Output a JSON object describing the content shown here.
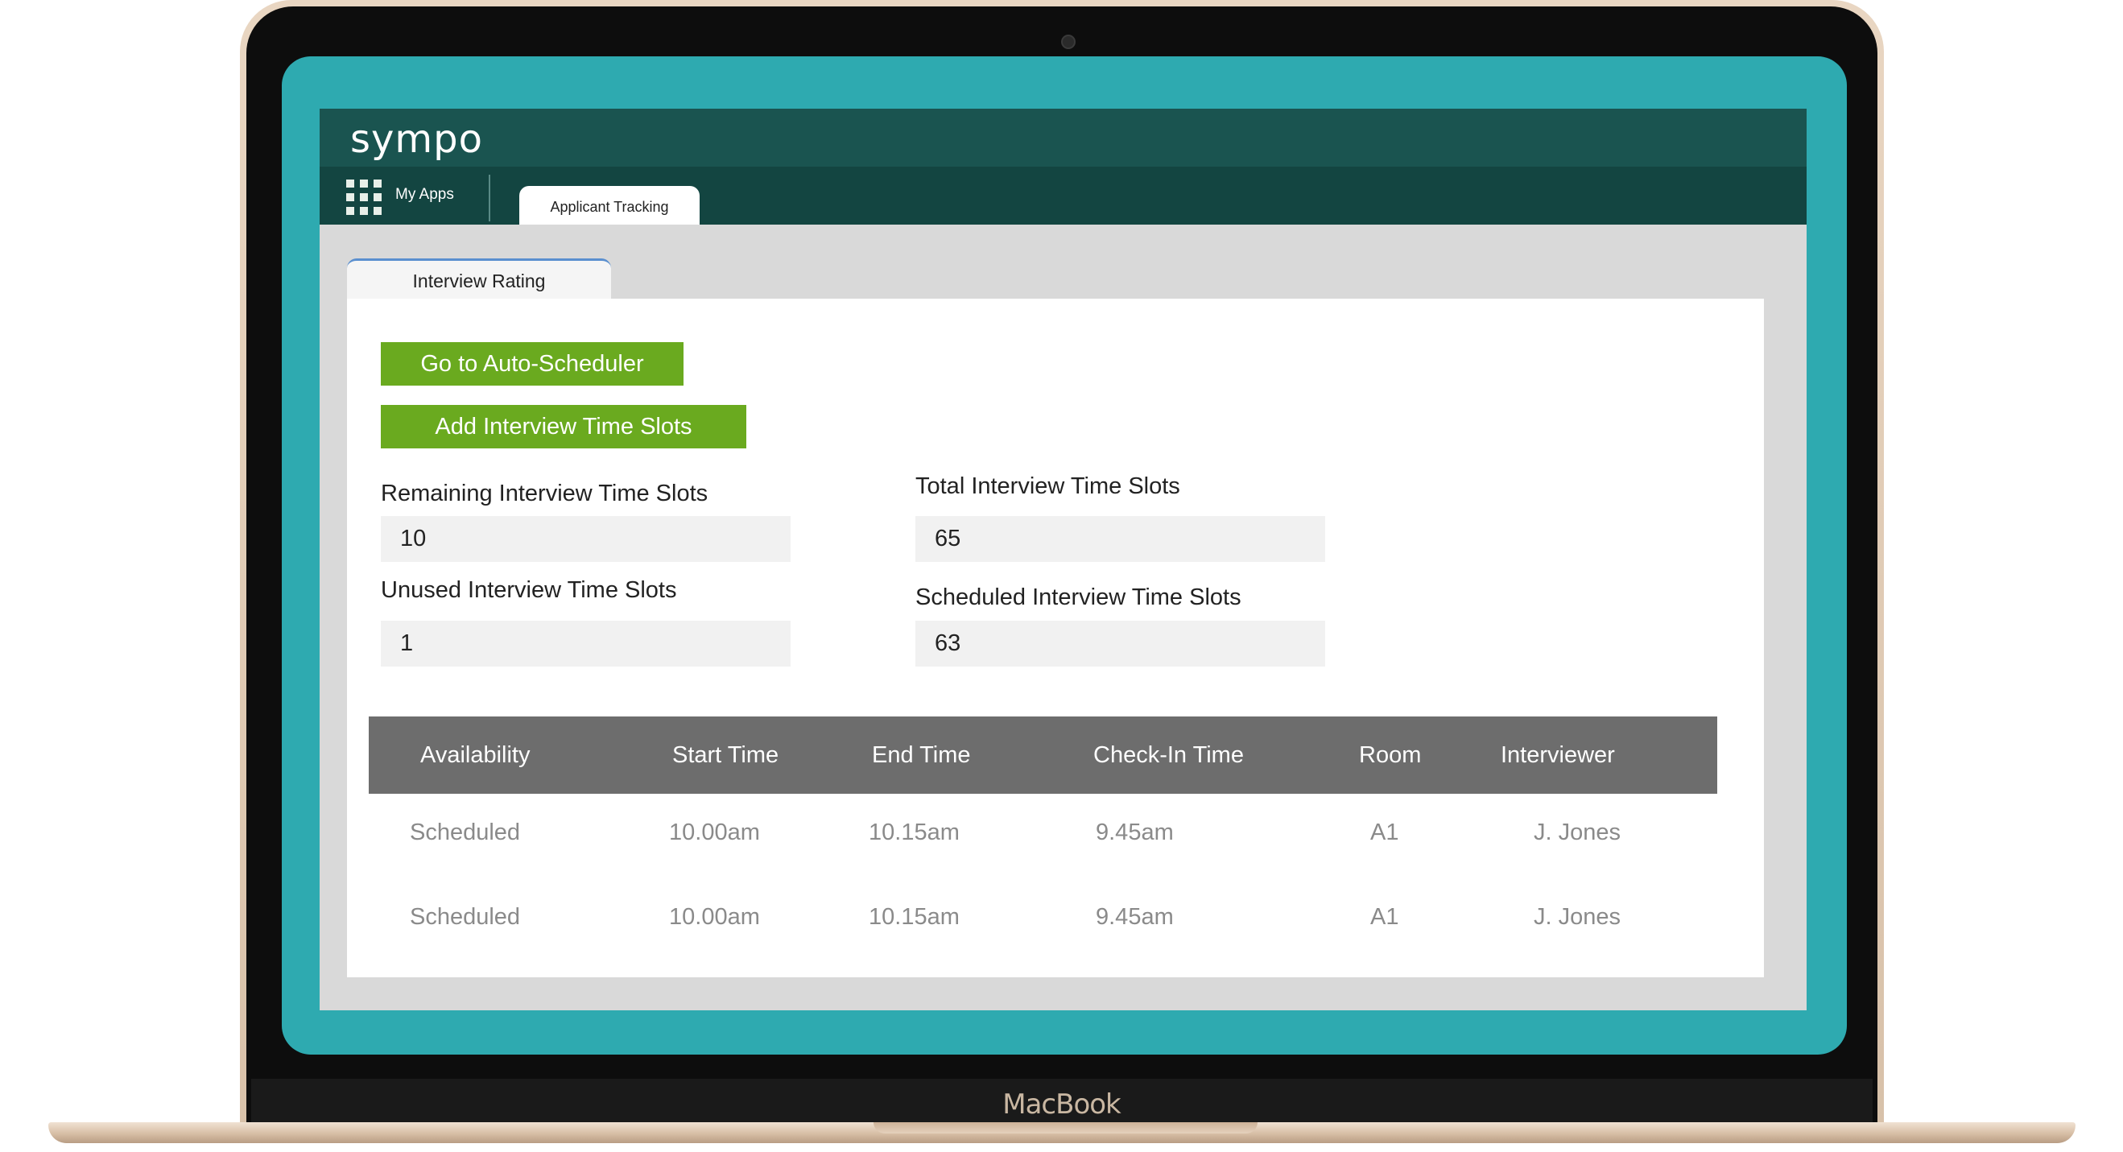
{
  "device_label": "MacBook",
  "app": {
    "logo_text": "sympo",
    "my_apps_label": "My Apps",
    "active_app_tab": "Applicant Tracking"
  },
  "page": {
    "tab_label": "Interview Rating",
    "buttons": {
      "auto_scheduler": "Go to Auto-Scheduler",
      "add_slots": "Add Interview Time Slots"
    },
    "fields": {
      "remaining": {
        "label": "Remaining Interview Time Slots",
        "value": "10"
      },
      "total": {
        "label": "Total Interview Time Slots",
        "value": "65"
      },
      "unused": {
        "label": "Unused Interview Time Slots",
        "value": "1"
      },
      "scheduled": {
        "label": "Scheduled Interview Time Slots",
        "value": "63"
      }
    },
    "table": {
      "columns": [
        "Availability",
        "Start Time",
        "End Time",
        "Check-In Time",
        "Room",
        "Interviewer"
      ],
      "rows": [
        [
          "Scheduled",
          "10.00am",
          "10.15am",
          "9.45am",
          "A1",
          "J. Jones"
        ],
        [
          "Scheduled",
          "10.00am",
          "10.15am",
          "9.45am",
          "A1",
          "J. Jones"
        ]
      ]
    }
  },
  "colors": {
    "teal_frame": "#2eaab0",
    "header_dark": "#1a5450",
    "nav_dark": "#134541",
    "button_green": "#6aaa1f",
    "table_header": "#6d6d6d"
  }
}
